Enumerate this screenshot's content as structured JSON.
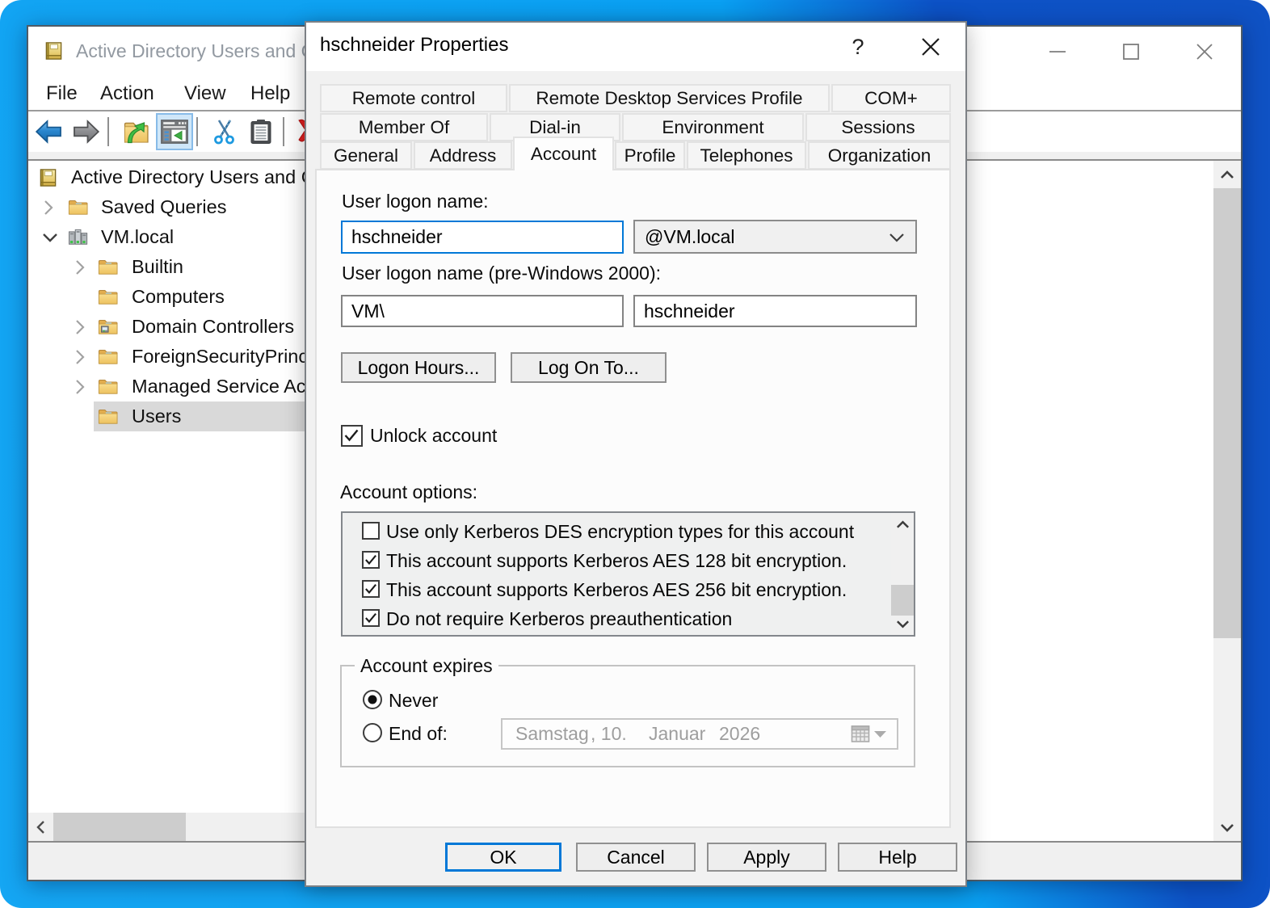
{
  "desktop": {
    "gradient_left": "#16a5f3",
    "gradient_right": "#0e51c4"
  },
  "main_window": {
    "title": "Active Directory Users and Computers",
    "menu": {
      "file": "File",
      "action": "Action",
      "view": "View",
      "help": "Help"
    },
    "toolbar_icons": [
      "back-icon",
      "forward-icon",
      "up-one-level-icon",
      "show-console-tree-icon",
      "cut-icon",
      "paste-icon",
      "delete-icon"
    ],
    "tree": {
      "root_label": "Active Directory Users and Computers",
      "items": [
        {
          "label": "Saved Queries",
          "state": "collapsed"
        },
        {
          "label": "VM.local",
          "state": "expanded"
        },
        {
          "label": "Builtin",
          "state": "collapsed"
        },
        {
          "label": "Computers",
          "state": "leaf"
        },
        {
          "label": "Domain Controllers",
          "state": "collapsed"
        },
        {
          "label": "ForeignSecurityPrincipals",
          "state": "collapsed"
        },
        {
          "label": "Managed Service Accounts",
          "state": "collapsed"
        },
        {
          "label": "Users",
          "state": "leaf",
          "selected": true
        }
      ]
    }
  },
  "dialog": {
    "title": "hschneider Properties",
    "help_glyph": "?",
    "tabs": {
      "row1": [
        {
          "label": "Remote control"
        },
        {
          "label": "Remote Desktop Services Profile"
        },
        {
          "label": "COM+"
        }
      ],
      "row2": [
        {
          "label": "Member Of"
        },
        {
          "label": "Dial-in"
        },
        {
          "label": "Environment"
        },
        {
          "label": "Sessions"
        }
      ],
      "row3": [
        {
          "label": "General"
        },
        {
          "label": "Address"
        },
        {
          "label": "Account",
          "active": true
        },
        {
          "label": "Profile"
        },
        {
          "label": "Telephones"
        },
        {
          "label": "Organization"
        }
      ]
    },
    "account_tab": {
      "user_logon_label": "User logon name:",
      "user_logon_value": "hschneider",
      "domain_suffix": "@VM.local",
      "pre2000_label": "User logon name (pre-Windows 2000):",
      "pre2000_domain": "VM\\",
      "pre2000_value": "hschneider",
      "logon_hours_button": "Logon Hours...",
      "log_on_to_button": "Log On To...",
      "unlock_account": {
        "label": "Unlock account",
        "checked": true
      },
      "account_options_label": "Account options:",
      "account_options": [
        {
          "label": "Use only Kerberos DES encryption types for this account",
          "checked": false
        },
        {
          "label": "This account supports Kerberos AES 128 bit encryption.",
          "checked": true
        },
        {
          "label": "This account supports Kerberos AES 256 bit encryption.",
          "checked": true
        },
        {
          "label": "Do not require Kerberos preauthentication",
          "checked": true
        }
      ],
      "account_expires": {
        "group_label": "Account expires",
        "never_label": "Never",
        "never_selected": true,
        "end_of_label": "End of:",
        "end_of_selected": false,
        "date_weekday": "Samstag",
        "date_day": ", 10.",
        "date_month": "Januar",
        "date_year": "2026"
      }
    },
    "buttons": {
      "ok": "OK",
      "cancel": "Cancel",
      "apply": "Apply",
      "help": "Help"
    }
  }
}
